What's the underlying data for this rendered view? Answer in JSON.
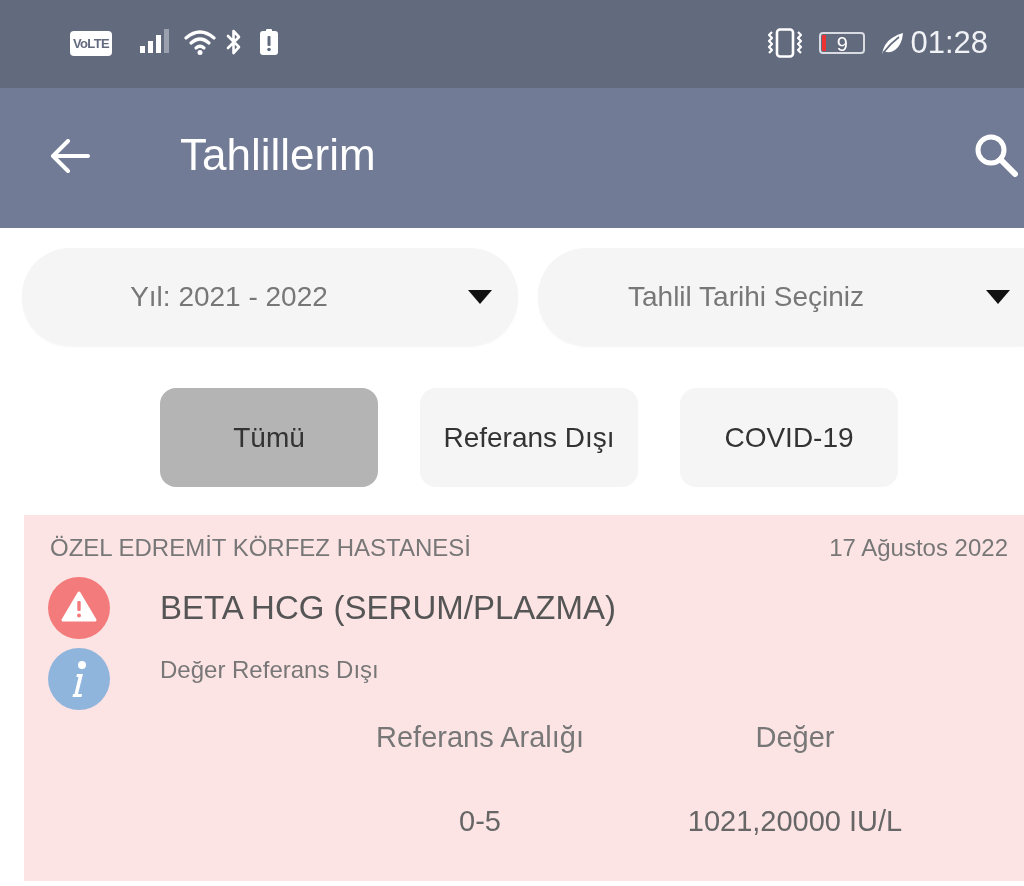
{
  "status_bar": {
    "badge": "VoLTE",
    "battery_percent": "9",
    "time": "01:28"
  },
  "app_bar": {
    "title": "Tahlillerim"
  },
  "dropdowns": [
    {
      "label": "Yıl: 2021 - 2022"
    },
    {
      "label": "Tahlil Tarihi Seçiniz"
    }
  ],
  "tabs": [
    {
      "label": "Tümü",
      "selected": true
    },
    {
      "label": "Referans Dışı",
      "selected": false
    },
    {
      "label": "COVID-19",
      "selected": false
    }
  ],
  "results": [
    {
      "hospital": "ÖZEL EDREMİT KÖRFEZ HASTANESİ",
      "date": "17 Ağustos 2022",
      "test": "BETA HCG (SERUM/PLAZMA)",
      "status": "Değer Referans Dışı",
      "out_of_range": true,
      "columns": [
        "Referans Aralığı",
        "Değer"
      ],
      "values": [
        "0-5",
        "1021,20000 IU/L"
      ]
    }
  ]
}
